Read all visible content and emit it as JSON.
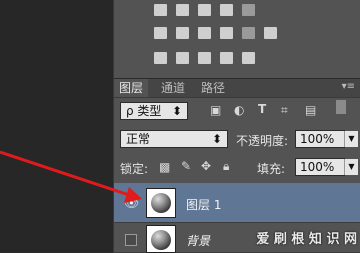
{
  "tabs": [
    {
      "label": "图层",
      "active": true
    },
    {
      "label": "通道",
      "active": false
    },
    {
      "label": "路径",
      "active": false
    }
  ],
  "filter": {
    "kind_label": "ρ 类型",
    "arrow": "⬍"
  },
  "blend": {
    "mode": "正常",
    "opacity_label": "不透明度:",
    "opacity_value": "100%"
  },
  "lock": {
    "label": "锁定:",
    "fill_label": "填充:",
    "fill_value": "100%"
  },
  "layers": [
    {
      "name": "图层 1",
      "visible": true,
      "selected": true
    },
    {
      "name": "背景",
      "visible": false,
      "selected": false
    }
  ],
  "watermark": "爱 刷 根 知 识 网",
  "colors": {
    "accent": "#5f7694",
    "arrow": "#e01b1b",
    "panel": "#535353"
  }
}
